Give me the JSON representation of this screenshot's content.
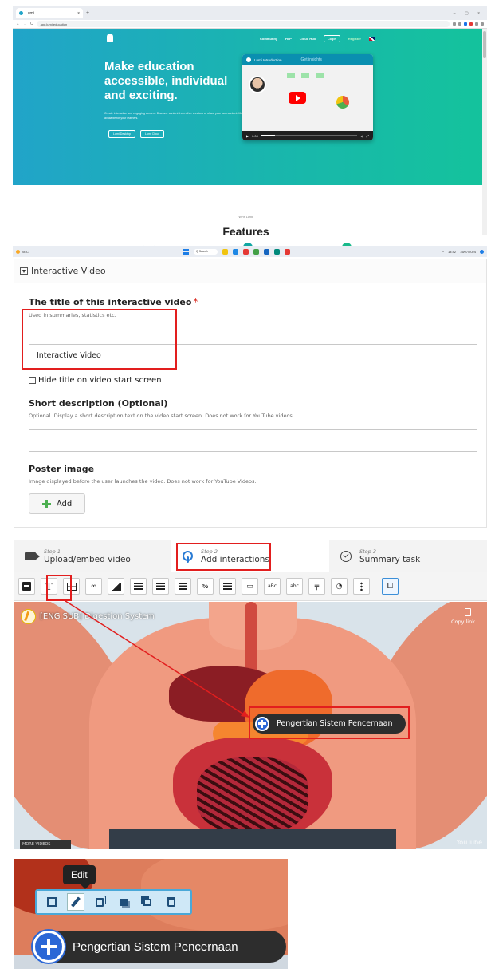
{
  "browser": {
    "tab_title": "Lumi",
    "url": "app.lumi.education",
    "nav": {
      "community": "Community",
      "h5p": "H5P",
      "cloud_hub": "Cloud Hub",
      "login": "Login",
      "register": "Register"
    },
    "hero": {
      "headline": "Make education accessible, individual and exciting.",
      "subtitle": "Create interactive and engaging content. Discover content from other creators or share your own content. Make your content available for your learners.",
      "cta_desktop": "Lumi Desktop",
      "cta_cloud": "Lumi Cloud",
      "video_title": "Lumi Introduction",
      "video_hint": "Get insights",
      "video_time": "0:00"
    },
    "features_kicker": "WHY LUMI",
    "features_title": "Features",
    "taskbar": {
      "weather": "28°C",
      "search": "Q Search",
      "time": "13:42",
      "date": "15/07/2024"
    }
  },
  "form": {
    "section_title": "Interactive Video",
    "title_label": "The title of this interactive video",
    "required_mark": "*",
    "title_desc": "Used in summaries, statistics etc.",
    "title_value": "Interactive Video",
    "hide_title_label": "Hide title on video start screen",
    "short_desc_label": "Short description (Optional)",
    "short_desc_help": "Optional. Display a short description text on the video start screen. Does not work for YouTube videos.",
    "short_desc_value": "",
    "poster_label": "Poster image",
    "poster_help": "Image displayed before the user launches the video. Does not work for YouTube Videos.",
    "add_label": "Add",
    "colors": {
      "highlight": "#e21e1e",
      "add_icon": "#4caf50"
    }
  },
  "editor": {
    "steps": [
      {
        "num": "Step 1",
        "name": "Upload/embed video",
        "icon": "camera-icon"
      },
      {
        "num": "Step 2",
        "name": "Add interactions",
        "icon": "hand-pointer-icon"
      },
      {
        "num": "Step 3",
        "name": "Summary task",
        "icon": "check-circle-icon"
      }
    ],
    "toolbar": {
      "text_tool": "T",
      "statements": "⁹⁄₂",
      "fill_blanks": "aBc",
      "drag_text": "abc"
    },
    "video": {
      "title": "[ENG SUB] Digestion System",
      "copy_link": "Copy link",
      "more_videos": "MORE VIDEOS",
      "yt_logo": "YouTube"
    },
    "hotspot_label": "Pengertian Sistem Pencernaan"
  },
  "zoom": {
    "tooltip": "Edit",
    "hotspot_label": "Pengertian Sistem Pencernaan",
    "colors": {
      "hotspot_icon": "#2b67d6",
      "toolbar_border": "#4aa8d8"
    }
  }
}
